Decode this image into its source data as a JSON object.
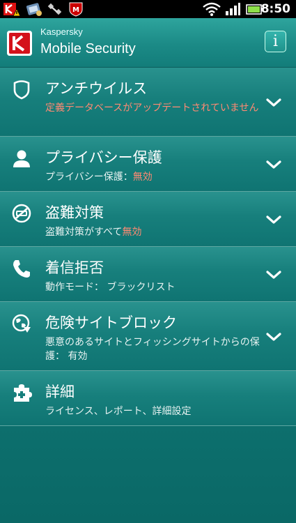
{
  "status_bar": {
    "time": "8:50",
    "notification_icons": [
      "kaspersky-warning-icon",
      "sync-icon",
      "satellite-icon",
      "mcafee-icon"
    ],
    "system_icons": [
      "wifi-icon",
      "signal-icon",
      "battery-icon"
    ]
  },
  "header": {
    "brand": "Kaspersky",
    "product": "Mobile Security",
    "info_label": "i"
  },
  "items": [
    {
      "title": "アンチウイルス",
      "sub_warning": "定義データベースがアップデートされていません",
      "icon": "shield-icon"
    },
    {
      "title": "プライバシー保護",
      "sub_prefix": "プライバシー保護：",
      "sub_status": "無効",
      "icon": "person-icon"
    },
    {
      "title": "盗難対策",
      "sub_prefix": "盗難対策がすべて",
      "sub_status": "無効",
      "icon": "anti-theft-icon"
    },
    {
      "title": "着信拒否",
      "sub": "動作モード： ブラックリスト",
      "icon": "phone-icon"
    },
    {
      "title": "危険サイトブロック",
      "sub": "悪意のあるサイトとフィッシングサイトからの保護： 有効",
      "icon": "globe-icon"
    },
    {
      "title": "詳細",
      "sub": "ライセンス、レポート、詳細設定",
      "icon": "puzzle-icon"
    }
  ],
  "colors": {
    "background": "#0b6f6d",
    "header": "#1b8a86",
    "warning_text": "#ff8a73"
  }
}
